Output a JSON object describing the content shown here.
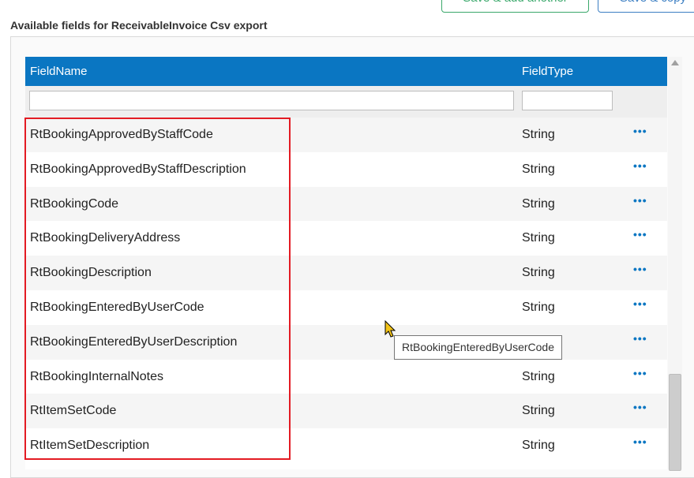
{
  "top_buttons": {
    "save_add_label": "Save & add another",
    "save_copy_label": "Save & copy"
  },
  "section": {
    "title": "Available fields for ReceivableInvoice Csv export"
  },
  "grid": {
    "columns": {
      "field_name": "FieldName",
      "field_type": "FieldType"
    },
    "filter": {
      "name_value": "",
      "type_value": ""
    },
    "row_menu_glyph": "•••",
    "rows": [
      {
        "name": "RtBookingApprovedByStaffCode",
        "type": "String"
      },
      {
        "name": "RtBookingApprovedByStaffDescription",
        "type": "String"
      },
      {
        "name": "RtBookingCode",
        "type": "String"
      },
      {
        "name": "RtBookingDeliveryAddress",
        "type": "String"
      },
      {
        "name": "RtBookingDescription",
        "type": "String"
      },
      {
        "name": "RtBookingEnteredByUserCode",
        "type": "String"
      },
      {
        "name": "RtBookingEnteredByUserDescription",
        "type": ""
      },
      {
        "name": "RtBookingInternalNotes",
        "type": "String"
      },
      {
        "name": "RtItemSetCode",
        "type": "String"
      },
      {
        "name": "RtItemSetDescription",
        "type": "String"
      }
    ]
  },
  "tooltip": {
    "text": "RtBookingEnteredByUserCode"
  },
  "colors": {
    "header_bg": "#0a76c2",
    "highlight_border": "#e31b23",
    "save_add_green": "#3aa86b",
    "save_copy_blue": "#3c7fc3"
  }
}
